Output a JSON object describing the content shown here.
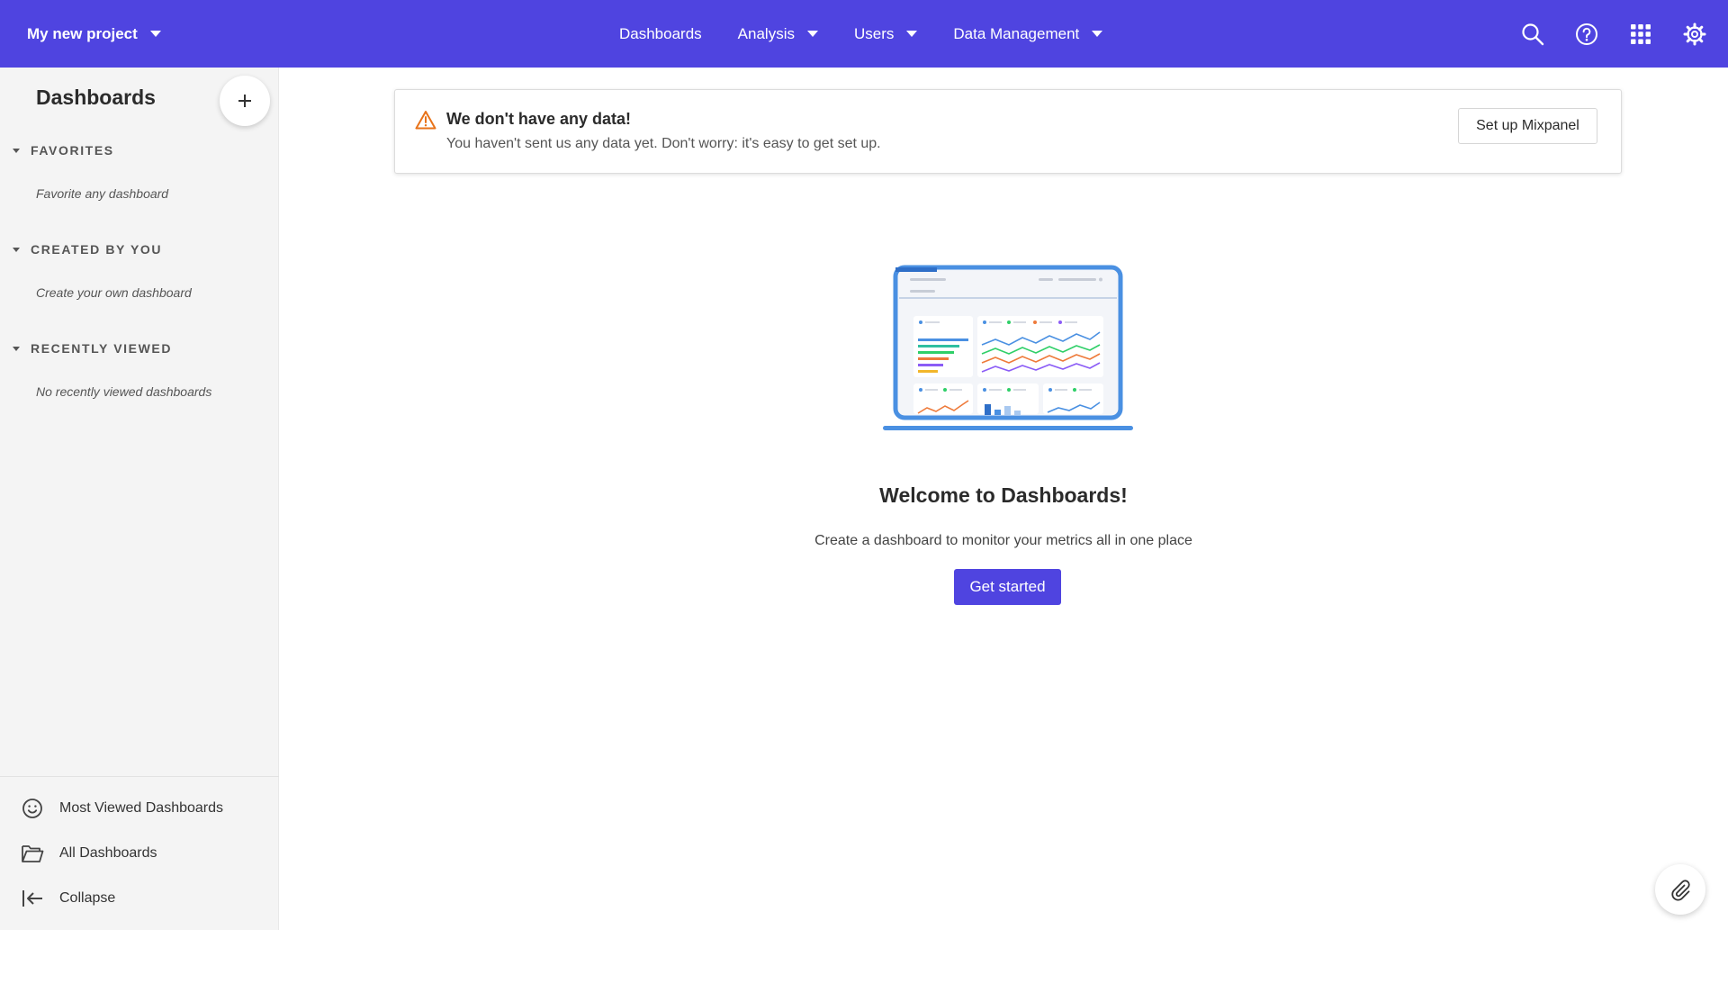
{
  "topbar": {
    "project_name": "My new project",
    "nav": [
      {
        "label": "Dashboards",
        "has_menu": false
      },
      {
        "label": "Analysis",
        "has_menu": true
      },
      {
        "label": "Users",
        "has_menu": true
      },
      {
        "label": "Data Management",
        "has_menu": true
      }
    ],
    "icons": [
      "search-icon",
      "help-icon",
      "apps-grid-icon",
      "gear-icon"
    ],
    "background": "#4f44e0"
  },
  "sidebar": {
    "title": "Dashboards",
    "sections": [
      {
        "label": "FAVORITES",
        "empty_text": "Favorite any dashboard"
      },
      {
        "label": "CREATED BY YOU",
        "empty_text": "Create your own dashboard"
      },
      {
        "label": "RECENTLY VIEWED",
        "empty_text": "No recently viewed dashboards"
      }
    ],
    "links": [
      {
        "label": "Most Viewed Dashboards",
        "icon": "smiley-icon"
      },
      {
        "label": "All Dashboards",
        "icon": "folder-open-icon"
      },
      {
        "label": "Collapse",
        "icon": "collapse-arrow-icon"
      }
    ]
  },
  "banner": {
    "title": "We don't have any data!",
    "subtitle": "You haven't sent us any data yet. Don't worry: it's easy to get set up.",
    "button_label": "Set up Mixpanel",
    "warning_color": "#e8731a"
  },
  "empty_state": {
    "title": "Welcome to Dashboards!",
    "subtitle": "Create a dashboard to monitor your metrics all in one place",
    "button_label": "Get started"
  }
}
